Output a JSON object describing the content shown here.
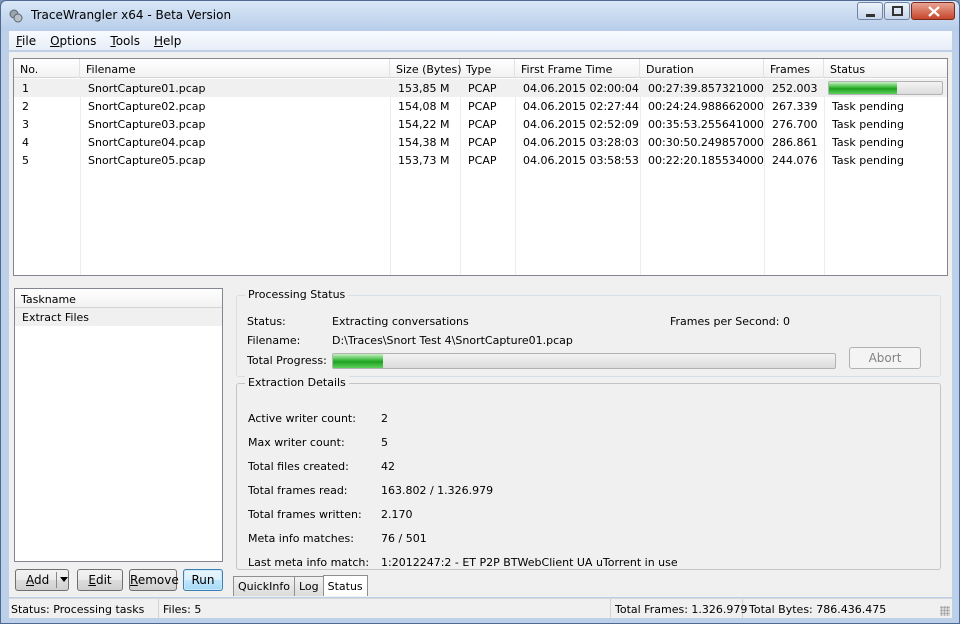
{
  "window": {
    "title": "TraceWrangler x64 - Beta Version"
  },
  "menu": [
    {
      "accel": "F",
      "rest": "ile"
    },
    {
      "accel": "O",
      "rest": "ptions"
    },
    {
      "accel": "T",
      "rest": "ools"
    },
    {
      "accel": "H",
      "rest": "elp"
    }
  ],
  "file_table": {
    "columns": [
      "No.",
      "Filename",
      "Size (Bytes)",
      "Type",
      "First Frame Time",
      "Duration",
      "Frames",
      "Status"
    ],
    "rows": [
      {
        "no": "1",
        "filename": "SnortCapture01.pcap",
        "size": "153,85 M",
        "type": "PCAP",
        "first": "04.06.2015 02:00:04",
        "duration": "00:27:39.857321000",
        "frames": "252.003",
        "status": "",
        "progress": 0.6
      },
      {
        "no": "2",
        "filename": "SnortCapture02.pcap",
        "size": "154,08 M",
        "type": "PCAP",
        "first": "04.06.2015 02:27:44",
        "duration": "00:24:24.988662000",
        "frames": "267.339",
        "status": "Task pending"
      },
      {
        "no": "3",
        "filename": "SnortCapture03.pcap",
        "size": "154,22 M",
        "type": "PCAP",
        "first": "04.06.2015 02:52:09",
        "duration": "00:35:53.255641000",
        "frames": "276.700",
        "status": "Task pending"
      },
      {
        "no": "4",
        "filename": "SnortCapture04.pcap",
        "size": "154,38 M",
        "type": "PCAP",
        "first": "04.06.2015 03:28:03",
        "duration": "00:30:50.249857000",
        "frames": "286.861",
        "status": "Task pending"
      },
      {
        "no": "5",
        "filename": "SnortCapture05.pcap",
        "size": "153,73 M",
        "type": "PCAP",
        "first": "04.06.2015 03:58:53",
        "duration": "00:22:20.185534000",
        "frames": "244.076",
        "status": "Task pending"
      }
    ]
  },
  "tasks": {
    "header": "Taskname",
    "items": [
      "Extract Files"
    ]
  },
  "task_buttons": {
    "add_accel": "A",
    "add_rest": "dd",
    "edit_accel": "E",
    "edit_rest": "dit",
    "remove_accel": "R",
    "remove_rest": "emove",
    "run": "Run"
  },
  "processing": {
    "title": "Processing Status",
    "status_label": "Status:",
    "status_value": "Extracting conversations",
    "fps_label": "Frames per Second:",
    "fps_value": "0",
    "filename_label": "Filename:",
    "filename_value": "D:\\Traces\\Snort Test 4\\SnortCapture01.pcap",
    "progress_label": "Total Progress:",
    "progress": 0.1,
    "abort": "Abort"
  },
  "extraction": {
    "title": "Extraction Details",
    "rows": [
      {
        "label": "Active writer count:",
        "value": "2"
      },
      {
        "label": "Max writer count:",
        "value": "5"
      },
      {
        "label": "Total files created:",
        "value": "42"
      },
      {
        "label": "Total frames read:",
        "value": "163.802 / 1.326.979"
      },
      {
        "label": "Total frames written:",
        "value": "2.170"
      },
      {
        "label": "Meta info matches:",
        "value": "76 / 501"
      },
      {
        "label": "Last meta info match:",
        "value": "1:2012247:2 - ET P2P BTWebClient UA uTorrent in use"
      }
    ]
  },
  "tabs": [
    "QuickInfo",
    "Log",
    "Status"
  ],
  "active_tab": "Status",
  "statusbar": {
    "status": "Status: Processing tasks",
    "files": "Files: 5",
    "total_frames": "Total Frames: 1.326.979",
    "total_bytes": "Total Bytes: 786.436.475"
  }
}
